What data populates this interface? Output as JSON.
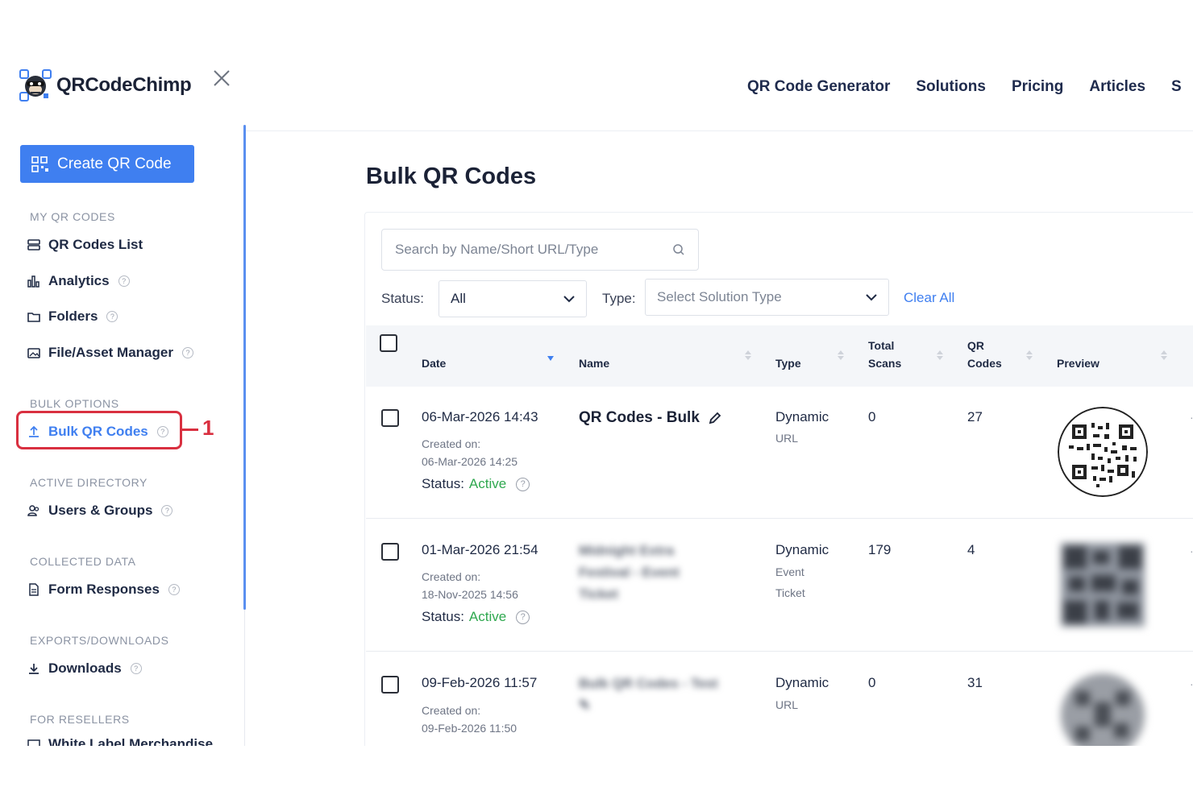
{
  "brand": {
    "name": "QRCodeChimp"
  },
  "topnav": [
    "QR Code Generator",
    "Solutions",
    "Pricing",
    "Articles",
    "S"
  ],
  "sidebar": {
    "create_label": "Create QR Code",
    "sections": {
      "my_qr_codes": "MY QR CODES",
      "bulk_options": "BULK OPTIONS",
      "active_directory": "ACTIVE DIRECTORY",
      "collected_data": "COLLECTED DATA",
      "exports": "EXPORTS/DOWNLOADS",
      "resellers": "FOR RESELLERS"
    },
    "items": {
      "qr_codes_list": "QR Codes List",
      "analytics": "Analytics",
      "folders": "Folders",
      "file_asset_manager": "File/Asset Manager",
      "bulk_qr_codes": "Bulk QR Codes",
      "users_groups": "Users & Groups",
      "form_responses": "Form Responses",
      "downloads": "Downloads",
      "white_label": "White Label Merchandise"
    },
    "annotation_number": "1"
  },
  "main": {
    "title": "Bulk QR Codes",
    "search_placeholder": "Search by Name/Short URL/Type",
    "filters": {
      "status_label": "Status:",
      "status_value": "All",
      "type_label": "Type:",
      "type_placeholder": "Select Solution Type",
      "clear_all": "Clear All"
    },
    "columns": {
      "date": "Date",
      "name": "Name",
      "type": "Type",
      "total_scans_1": "Total",
      "total_scans_2": "Scans",
      "qr_codes_1": "QR",
      "qr_codes_2": "Codes",
      "preview": "Preview"
    },
    "rows": [
      {
        "date": "06-Mar-2026 14:43",
        "created_label": "Created on:",
        "created": "06-Mar-2026 14:25",
        "status_label": "Status:",
        "status": "Active",
        "name": "QR Codes - Bulk",
        "type": "Dynamic",
        "subtype": "URL",
        "scans": "0",
        "codes": "27"
      },
      {
        "date": "01-Mar-2026 21:54",
        "created_label": "Created on:",
        "created": "18-Nov-2025 14:56",
        "status_label": "Status:",
        "status": "Active",
        "name_line1": "Midnight Extra",
        "name_line2": "Festival - Event",
        "name_line3": "Ticket",
        "type": "Dynamic",
        "subtype_line1": "Event",
        "subtype_line2": "Ticket",
        "scans": "179",
        "codes": "4"
      },
      {
        "date": "09-Feb-2026 11:57",
        "created_label": "Created on:",
        "created": "09-Feb-2026 11:50",
        "name_line1": "Bulk QR Codes - Test",
        "type": "Dynamic",
        "subtype": "URL",
        "scans": "0",
        "codes": "31"
      }
    ]
  },
  "colors": {
    "accent": "#3f7ff0",
    "active": "#2fa84f",
    "highlight": "#d93040"
  }
}
